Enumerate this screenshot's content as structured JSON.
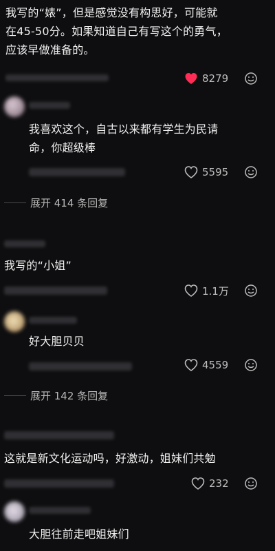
{
  "comments": [
    {
      "text_lines": [
        "我写的“婊”，但是感觉没有构思好，可能就",
        "在45-50分。如果知道自己有写这个的勇气，",
        "应该早做准备的。"
      ],
      "likes": "8279",
      "liked": true
    },
    {
      "text_lines": [
        "我喜欢这个，自古以来都有学生为民请",
        "命，你超级棒"
      ],
      "likes": "5595",
      "liked": false,
      "replies_label": "展开 414 条回复"
    },
    {
      "text_lines": [
        "我写的“小姐”"
      ],
      "likes": "1.1万",
      "liked": false
    },
    {
      "text_lines": [
        "好大胆贝贝"
      ],
      "likes": "4559",
      "liked": false,
      "replies_label": "展开 142 条回复"
    },
    {
      "text_lines": [
        "这就是新文化运动吗，好激动，姐妹们共勉"
      ],
      "likes": "232",
      "liked": false
    },
    {
      "text_lines": [
        "大胆往前走吧姐妹们"
      ]
    }
  ],
  "colors": {
    "background": "#0e0e10",
    "liked_heart": "#ff2c55",
    "muted": "#bdbdbd"
  },
  "icons": {
    "like": "heart-icon",
    "dislike": "smile-icon"
  }
}
